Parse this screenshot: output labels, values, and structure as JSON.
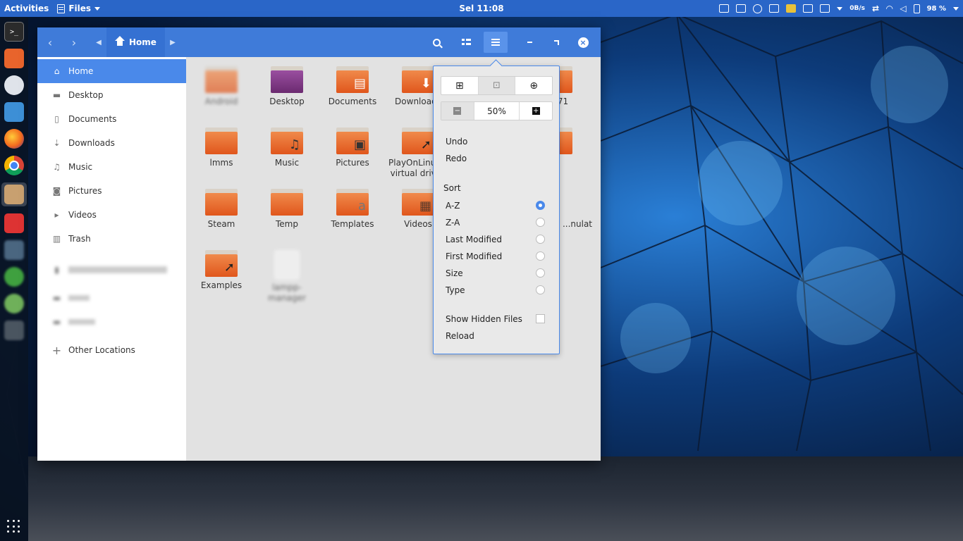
{
  "topbar": {
    "activities": "Activities",
    "app_name": "Files",
    "clock": "Sel 11:08",
    "net_speed": "0B/s",
    "battery": "98 %"
  },
  "window": {
    "path_home": "Home"
  },
  "sidebar": {
    "items": [
      {
        "label": "Home",
        "icon": "home-icon"
      },
      {
        "label": "Desktop",
        "icon": "folder-icon"
      },
      {
        "label": "Documents",
        "icon": "document-icon"
      },
      {
        "label": "Downloads",
        "icon": "download-icon"
      },
      {
        "label": "Music",
        "icon": "music-icon"
      },
      {
        "label": "Pictures",
        "icon": "camera-icon"
      },
      {
        "label": "Videos",
        "icon": "video-icon"
      },
      {
        "label": "Trash",
        "icon": "trash-icon"
      }
    ],
    "other_locations": "Other Locations"
  },
  "files": [
    {
      "label": "Android",
      "blurred": true
    },
    {
      "label": "Desktop"
    },
    {
      "label": "Documents"
    },
    {
      "label": "Downloads"
    },
    {
      "label": "...171"
    },
    {
      "label": "lmms"
    },
    {
      "label": "Music"
    },
    {
      "label": "Pictures"
    },
    {
      "label": "PlayOnLinux's virtual drives"
    },
    {
      "label": "Steam"
    },
    {
      "label": "Temp"
    },
    {
      "label": "Templates"
    },
    {
      "label": "Videos"
    },
    {
      "label": "...nulat"
    },
    {
      "label": "Examples"
    },
    {
      "label": "lampp-manager",
      "blurred": true
    }
  ],
  "popover": {
    "zoom_level": "50%",
    "undo": "Undo",
    "redo": "Redo",
    "sort_heading": "Sort",
    "sort_options": [
      "A-Z",
      "Z-A",
      "Last Modified",
      "First Modified",
      "Size",
      "Type"
    ],
    "sort_selected": "A-Z",
    "show_hidden": "Show Hidden Files",
    "show_hidden_checked": false,
    "reload": "Reload"
  },
  "colors": {
    "accent": "#4a89ea",
    "headerbar": "#3f7bd9",
    "topbar": "#2a66c8",
    "folder": "#e86a2e"
  }
}
